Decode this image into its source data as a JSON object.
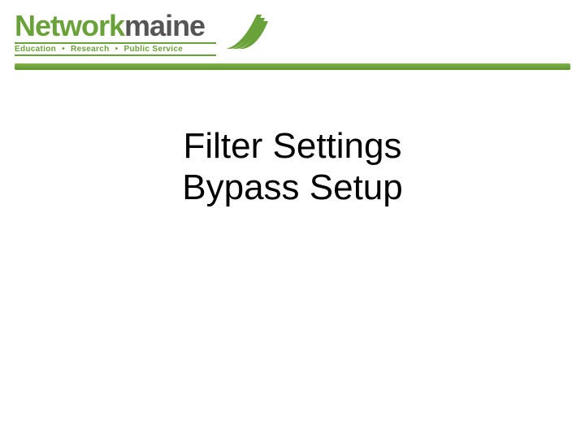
{
  "brand": {
    "part1": "Network",
    "part2": "maine"
  },
  "tagline": {
    "t1": "Education",
    "t2": "Research",
    "t3": "Public Service",
    "sep": "•"
  },
  "title": {
    "line1": "Filter Settings",
    "line2": "Bypass Setup"
  }
}
